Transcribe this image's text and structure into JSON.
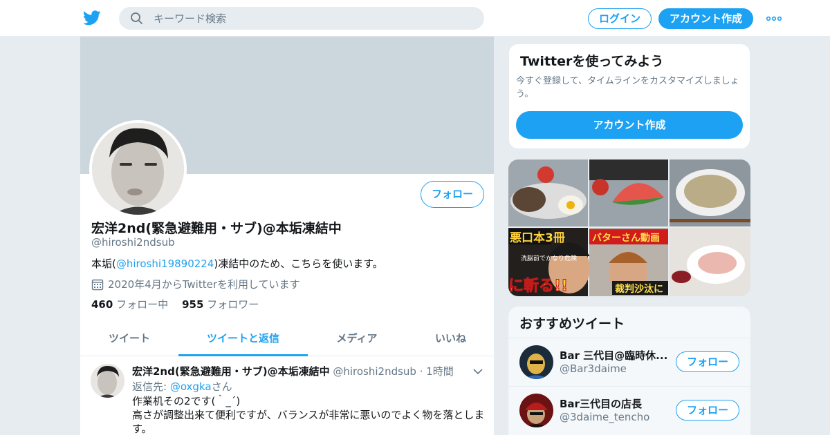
{
  "header": {
    "search_placeholder": "キーワード検索",
    "login_label": "ログイン",
    "signup_label": "アカウント作成"
  },
  "profile": {
    "name": "宏洋2nd(緊急避難用・サブ)@本垢凍結中",
    "handle": "@hiroshi2ndsub",
    "follow_label": "フォロー",
    "bio_prefix": "本垢(",
    "bio_link": "@hiroshi19890224",
    "bio_suffix": ")凍結中のため、こちらを使います。",
    "joined": "2020年4月からTwitterを利用しています",
    "following_count": "460",
    "following_label": "フォロー中",
    "followers_count": "955",
    "followers_label": "フォロワー"
  },
  "tabs": [
    {
      "label": "ツイート",
      "active": false
    },
    {
      "label": "ツイートと返信",
      "active": true
    },
    {
      "label": "メディア",
      "active": false
    },
    {
      "label": "いいね",
      "active": false
    }
  ],
  "tweet": {
    "name": "宏洋2nd(緊急避難用・サブ)@本垢凍結中",
    "handle": "@hiroshi2ndsub",
    "time": "1時間",
    "reply_prefix": "返信先: ",
    "reply_to": "@oxgka",
    "reply_suffix": "さん",
    "line1": "作業机その2です(｀_´)",
    "line2": "高さが調整出来て便利ですが、バランスが非常に悪いのでよく物を落とします。"
  },
  "signup_card": {
    "title": "Twitterを使ってみよう",
    "body": "今すぐ登録して、タイムラインをカスタマイズしましょう。",
    "button": "アカウント作成"
  },
  "media_thumbs": {
    "banner1": "悪口本3冊",
    "banner1_sub": "洗脳前でかなり危険",
    "banner1_bottom": "に斬る!!",
    "banner2": "バターさん動画",
    "banner2_bottom": "裁判沙汰に"
  },
  "recommended": {
    "title": "おすすめツイート",
    "users": [
      {
        "name": "Bar 三代目@臨時休...",
        "handle": "@Bar3daime",
        "follow_label": "フォロー"
      },
      {
        "name": "Bar三代目の店長",
        "handle": "@3daime_tencho",
        "follow_label": "フォロー"
      }
    ]
  },
  "colors": {
    "accent": "#1da1f2",
    "text": "#14171a",
    "muted": "#657786",
    "background": "#e6ecf0"
  }
}
